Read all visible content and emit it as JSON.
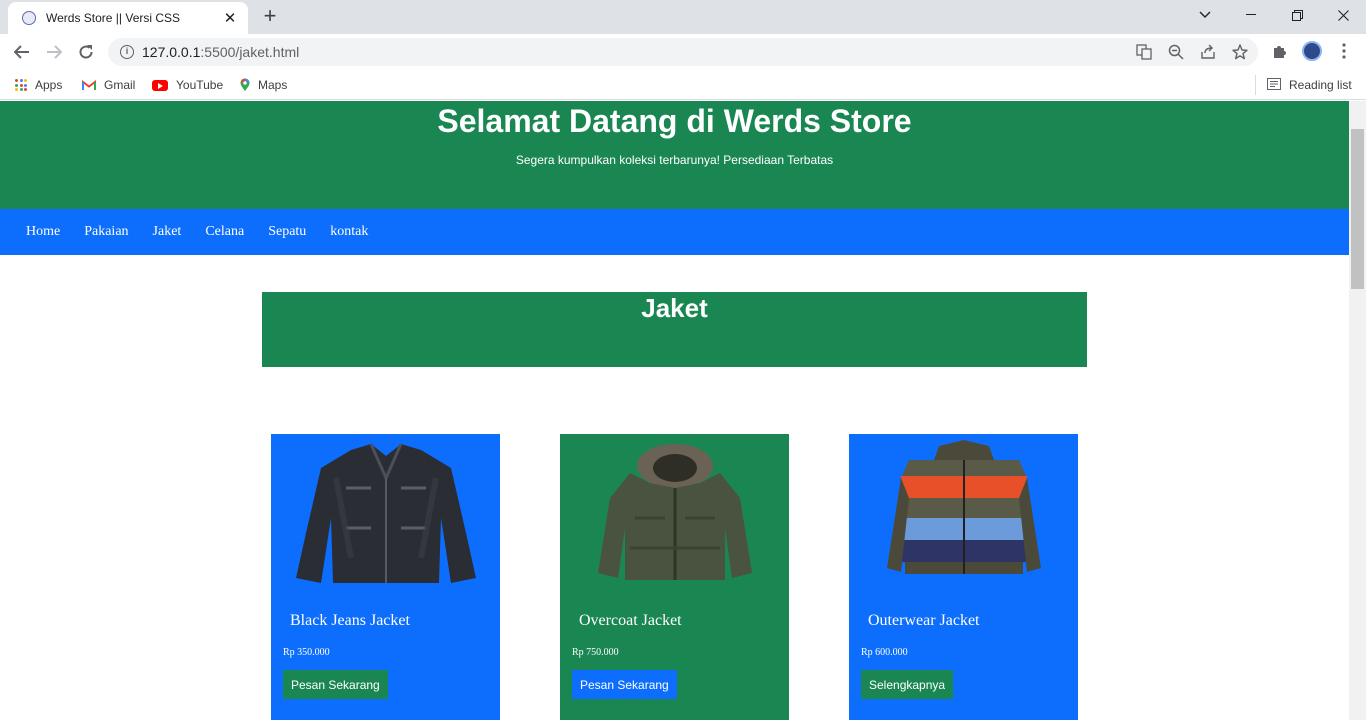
{
  "browser": {
    "tab_title": "Werds Store || Versi CSS",
    "url_host": "127.0.0.1",
    "url_rest": ":5500/jaket.html",
    "bookmarks": [
      {
        "label": "Apps"
      },
      {
        "label": "Gmail"
      },
      {
        "label": "YouTube"
      },
      {
        "label": "Maps"
      }
    ],
    "reading_list": "Reading list"
  },
  "header": {
    "title": "Selamat Datang di Werds Store",
    "subtitle": "Segera kumpulkan koleksi terbarunya! Persediaan Terbatas"
  },
  "nav": {
    "items": [
      "Home",
      "Pakaian",
      "Jaket",
      "Celana",
      "Sepatu",
      "kontak"
    ]
  },
  "section": {
    "title": "Jaket"
  },
  "colors": {
    "green": "#1a8753",
    "blue": "#0d6efd"
  },
  "products": [
    {
      "name": "Black Jeans Jacket",
      "price": "Rp 350.000",
      "button": "Pesan Sekarang",
      "image": "denim-jacket-image"
    },
    {
      "name": "Overcoat Jacket",
      "price": "Rp 750.000",
      "button": "Pesan Sekarang",
      "image": "parka-jacket-image"
    },
    {
      "name": "Outerwear Jacket",
      "price": "Rp 600.000",
      "button": "Selengkapnya",
      "image": "puffer-jacket-image"
    }
  ]
}
